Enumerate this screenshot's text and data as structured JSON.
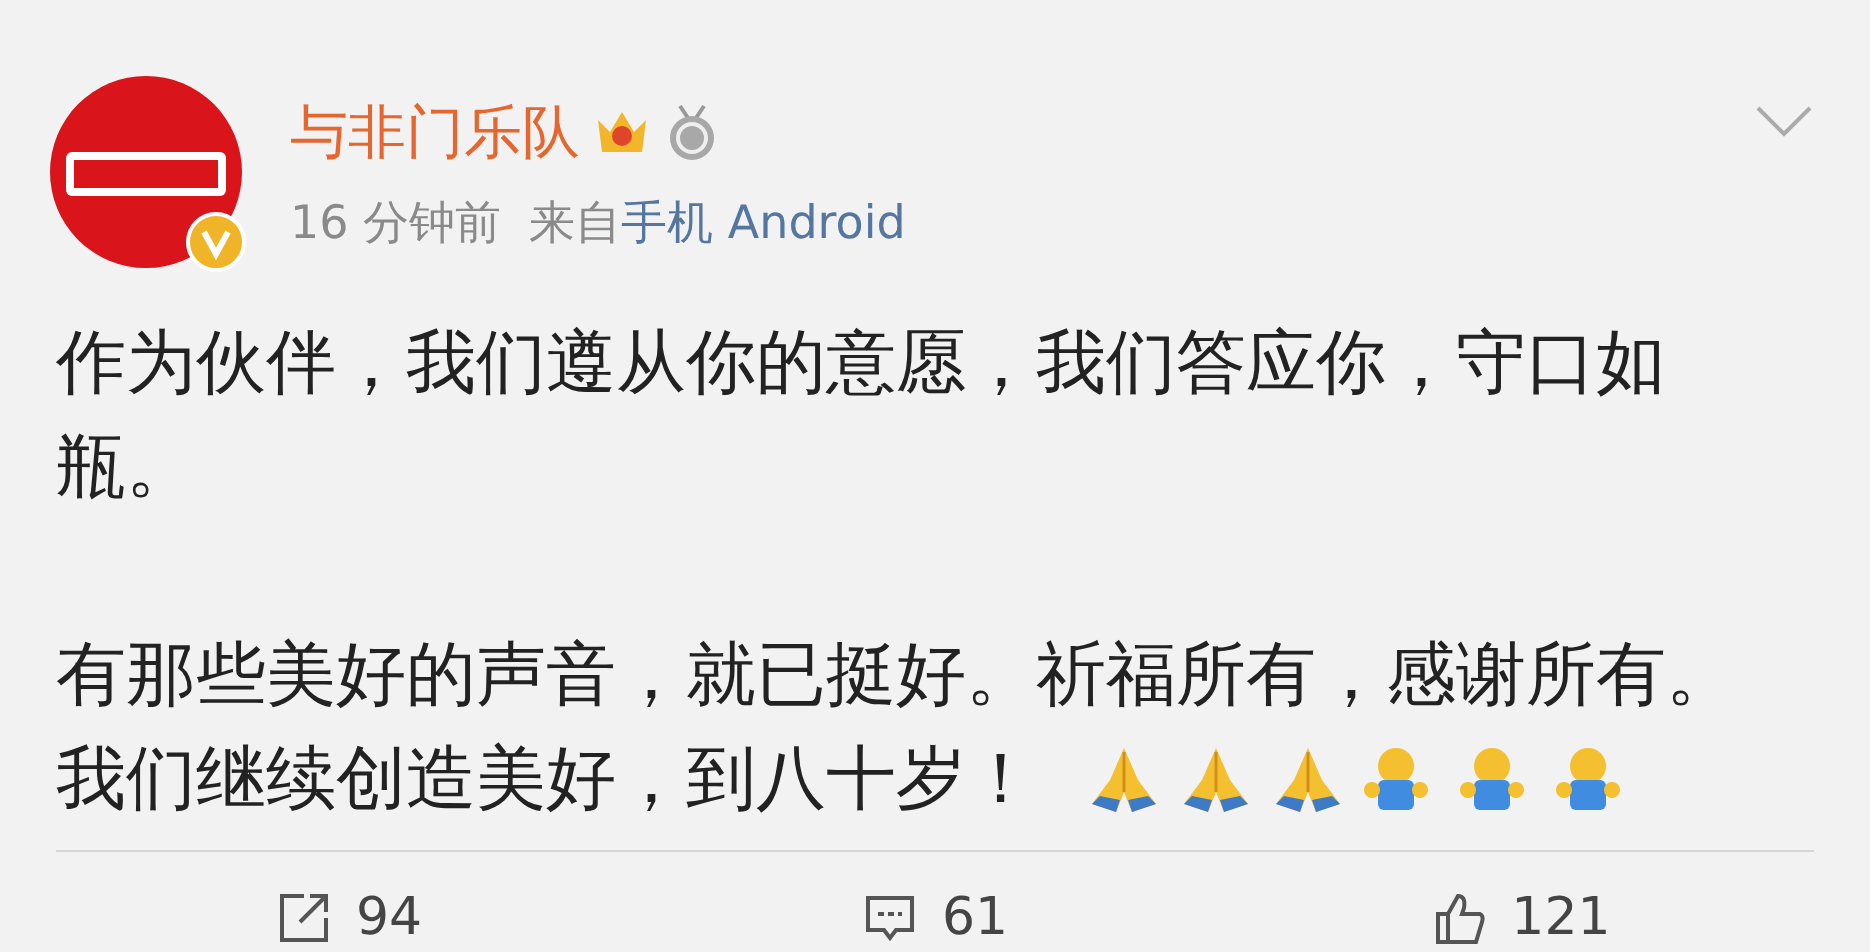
{
  "post": {
    "author": "与非门乐队",
    "verified": true,
    "time": "16 分钟前",
    "source_prefix": "来自",
    "source": "手机 Android",
    "paragraphs": [
      {
        "lines": [
          {
            "text": "作为伙伴，我们遵从你的意愿，我们答应你，守口如瓶。"
          }
        ]
      },
      {
        "lines": [
          {
            "text": "有那些美好的声音，就已挺好。祈福所有，感谢所有。"
          },
          {
            "text": "我们继续创造美好，到八十岁！",
            "emojis": [
              {
                "kind": "pray"
              },
              {
                "kind": "pray"
              },
              {
                "kind": "pray"
              },
              {
                "kind": "figure"
              },
              {
                "kind": "figure"
              },
              {
                "kind": "figure"
              }
            ]
          }
        ]
      }
    ]
  },
  "actions": [
    {
      "kind": "repost",
      "count": "94"
    },
    {
      "kind": "comment",
      "count": "61"
    },
    {
      "kind": "like",
      "count": "121"
    }
  ]
}
